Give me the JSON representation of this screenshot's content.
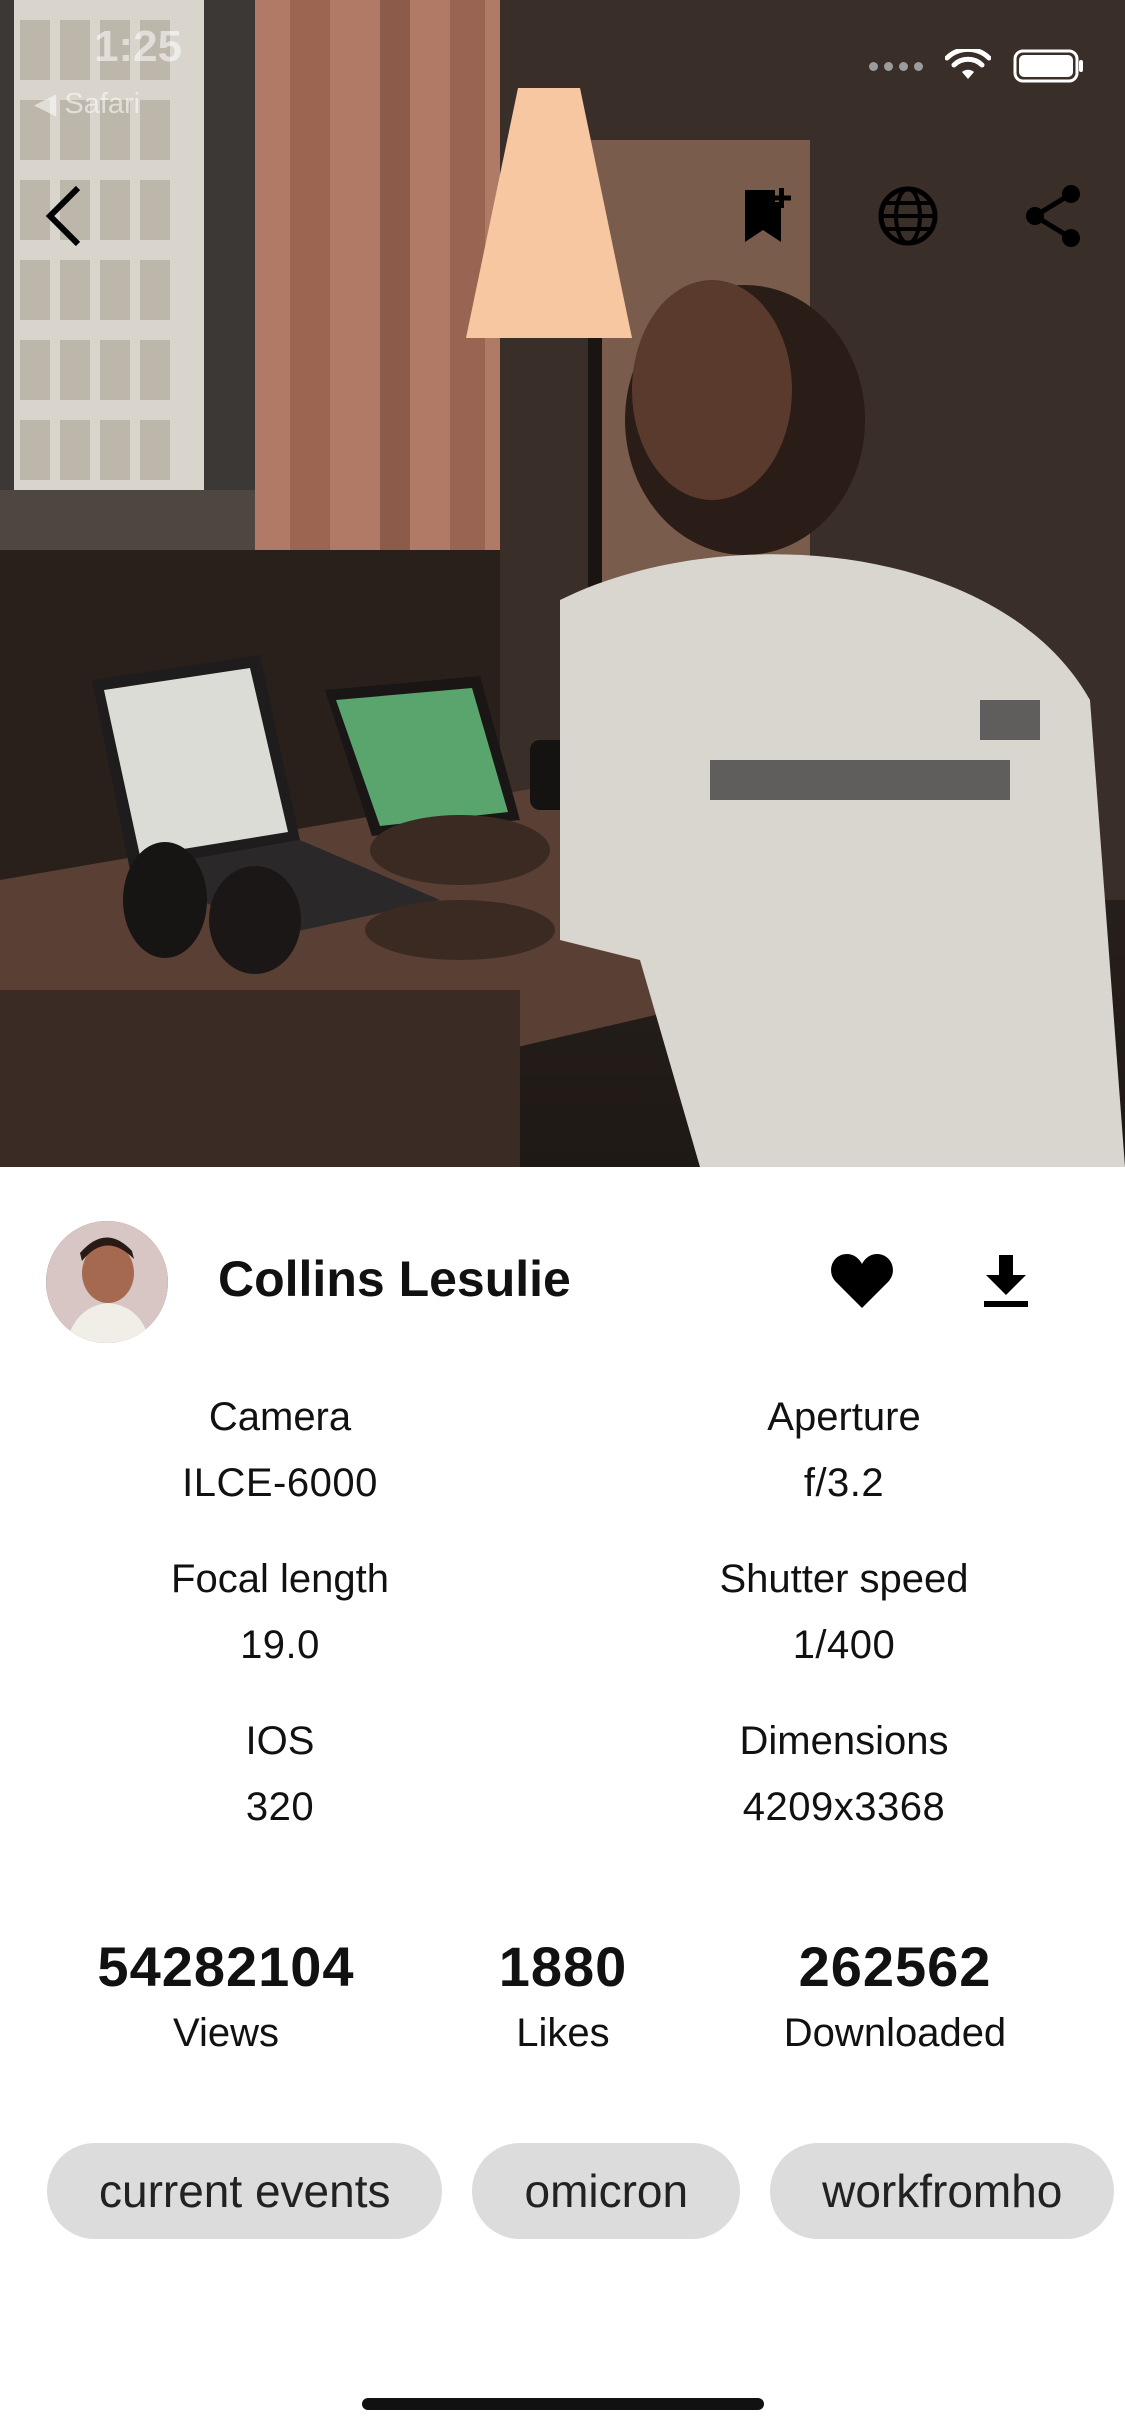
{
  "status_bar": {
    "time": "1:25",
    "back_app": "◀ Safari"
  },
  "nav": {
    "back_icon": "chevron-left-icon",
    "bookmark_icon": "bookmark-add-icon",
    "globe_icon": "globe-icon",
    "share_icon": "share-icon"
  },
  "author": {
    "name": "Collins Lesulie"
  },
  "actions": {
    "like_icon": "heart-icon",
    "download_icon": "download-icon"
  },
  "meta": [
    {
      "label": "Camera",
      "value": "ILCE-6000"
    },
    {
      "label": "Aperture",
      "value": "f/3.2"
    },
    {
      "label": "Focal length",
      "value": "19.0"
    },
    {
      "label": "Shutter speed",
      "value": "1/400"
    },
    {
      "label": "IOS",
      "value": "320"
    },
    {
      "label": "Dimensions",
      "value": "4209x3368"
    }
  ],
  "stats": {
    "views": {
      "value": "54282104",
      "label": "Views"
    },
    "likes": {
      "value": "1880",
      "label": "Likes"
    },
    "downloads": {
      "value": "262562",
      "label": "Downloaded"
    }
  },
  "tags": [
    "current events",
    "omicron",
    "workfromho"
  ]
}
